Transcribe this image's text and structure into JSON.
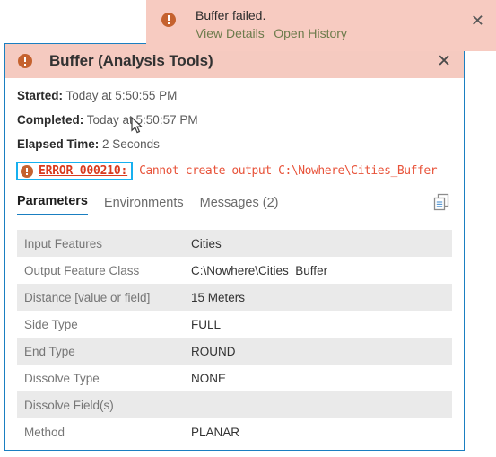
{
  "toast": {
    "icon": "error-circle-icon",
    "title": "Buffer failed.",
    "links": [
      {
        "label": "View Details"
      },
      {
        "label": "Open History"
      }
    ],
    "close_label": "✕"
  },
  "dialog": {
    "icon": "error-circle-icon",
    "title": "Buffer (Analysis Tools)",
    "close_label": "✕",
    "meta": [
      {
        "label": "Started:",
        "value": " Today at 5:50:55 PM"
      },
      {
        "label": "Completed:",
        "value": " Today at 5:50:57 PM"
      },
      {
        "label": "Elapsed Time:",
        "value": " 2 Seconds"
      }
    ],
    "error": {
      "icon": "error-circle-icon",
      "code": "ERROR 000210:",
      "message": "Cannot create output C:\\Nowhere\\Cities_Buffer"
    },
    "tabs": [
      {
        "label": "Parameters",
        "active": true
      },
      {
        "label": "Environments",
        "active": false
      },
      {
        "label": "Messages (2)",
        "active": false
      }
    ],
    "copy_icon": "copy-icon",
    "parameters": [
      {
        "name": "Input Features",
        "value": "Cities"
      },
      {
        "name": "Output Feature Class",
        "value": "C:\\Nowhere\\Cities_Buffer"
      },
      {
        "name": "Distance [value or field]",
        "value": "15 Meters"
      },
      {
        "name": "Side Type",
        "value": "FULL"
      },
      {
        "name": "End Type",
        "value": "ROUND"
      },
      {
        "name": "Dissolve Type",
        "value": "NONE"
      },
      {
        "name": "Dissolve Field(s)",
        "value": ""
      },
      {
        "name": "Method",
        "value": "PLANAR"
      }
    ]
  },
  "colors": {
    "banner_bg": "#f7cbc1",
    "dialog_border": "#1a7fc1",
    "error_red": "#e8533a",
    "error_link_red": "#d93a1e",
    "focus_cyan": "#17b0ef",
    "tab_underline": "#1a7fc1",
    "row_stripe": "#eaeaea",
    "link_green": "#6d7b4c",
    "icon_orange": "#c5622f"
  }
}
